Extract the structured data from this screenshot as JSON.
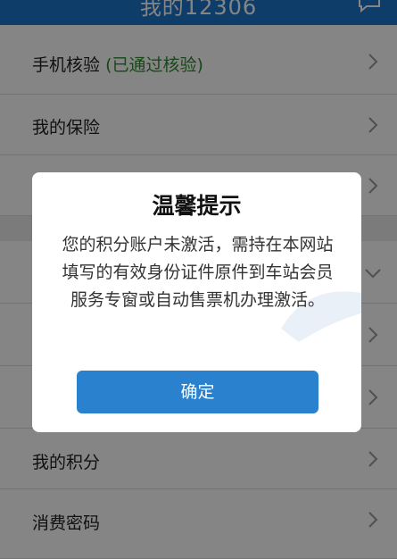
{
  "header": {
    "title": "我的12306",
    "icon": "message-icon"
  },
  "list": {
    "phone_check_label": "手机核验",
    "phone_check_status": "(已通过核验)",
    "insurance_label": "我的保险",
    "points_label": "我的积分",
    "password_label": "消费密码"
  },
  "dialog": {
    "title": "温馨提示",
    "message": "您的积分账户未激活，需持在本网站填写的有效身份证件原件到车站会员服务专窗或自动售票机办理激活。",
    "confirm_label": "确定"
  },
  "colors": {
    "header_blue": "#1b76c9",
    "button_blue": "#2a82cf",
    "verified_green": "#2e8b2e"
  }
}
